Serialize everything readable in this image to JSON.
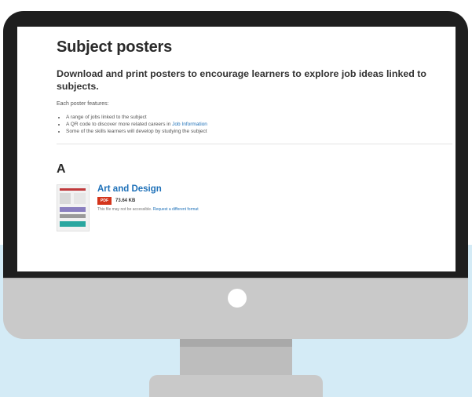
{
  "page": {
    "title": "Subject posters",
    "lead": "Download and print posters to encourage learners to explore job ideas linked to subjects.",
    "intro": "Each poster features:",
    "features": [
      "A range of jobs linked to the subject",
      "A QR code to discover more related careers in ",
      "Some of the skills learners will develop by studying the subject"
    ],
    "feature_link": "Job Information",
    "section_letter": "A",
    "item": {
      "title": "Art and Design",
      "badge": "PDF",
      "size": "73.64 KB",
      "note_prefix": "This file may not be accessible.",
      "note_link": "Request a different format"
    }
  },
  "colors": {
    "link": "#1d70b8",
    "badge": "#d4351c",
    "background_band": "#d4ebf6",
    "bezel": "#1e1e1e"
  },
  "icons": [
    "monitor-camera-icon",
    "poster-thumbnail"
  ]
}
